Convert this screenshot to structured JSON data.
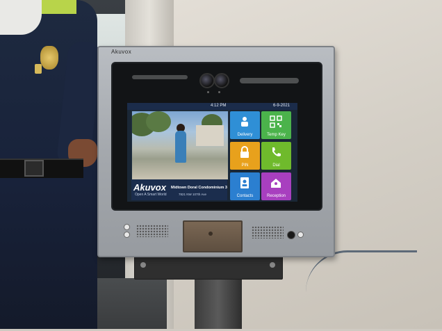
{
  "device": {
    "brand_label": "Akuvox"
  },
  "screen": {
    "time": "4:12 PM",
    "date": "6-9-2021",
    "logo": "Akuvox",
    "tagline": "Open A Smart World",
    "address_line1": "Midtown Doral Condominium 3",
    "address_line2": "7821 NW 107th Ave"
  },
  "tiles": [
    {
      "label": "Delivery",
      "color": "#2f8fd6",
      "icon": "delivery-person-icon"
    },
    {
      "label": "Temp Key",
      "color": "#4bb34b",
      "icon": "qr-code-icon"
    },
    {
      "label": "PIN",
      "color": "#e8a11c",
      "icon": "lock-icon"
    },
    {
      "label": "Dial",
      "color": "#6fba2c",
      "icon": "phone-icon"
    },
    {
      "label": "Contacts",
      "color": "#2b7fd0",
      "icon": "contacts-icon"
    },
    {
      "label": "Reception",
      "color": "#a83fbf",
      "icon": "reception-icon"
    }
  ]
}
